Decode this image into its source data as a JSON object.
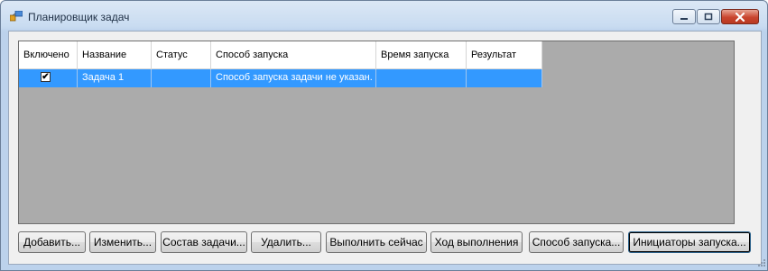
{
  "window": {
    "title": "Планировщик задач"
  },
  "grid": {
    "columns": [
      "Включено",
      "Название",
      "Статус",
      "Способ запуска",
      "Время запуска",
      "Результат"
    ],
    "rows": [
      {
        "enabled": "✔",
        "name": "Задача 1",
        "status": "",
        "launch_method": "Способ запуска задачи не указан.",
        "launch_time": "",
        "result": ""
      }
    ]
  },
  "buttons": {
    "add": "Добавить...",
    "edit": "Изменить...",
    "composition": "Состав задачи...",
    "delete": "Удалить...",
    "run_now": "Выполнить сейчас",
    "progress": "Ход выполнения",
    "launch_method": "Способ запуска...",
    "initiators": "Инициаторы запуска..."
  },
  "colors": {
    "selection": "#3399ff",
    "grid_background": "#ababab",
    "close_button": "#c9452e"
  }
}
